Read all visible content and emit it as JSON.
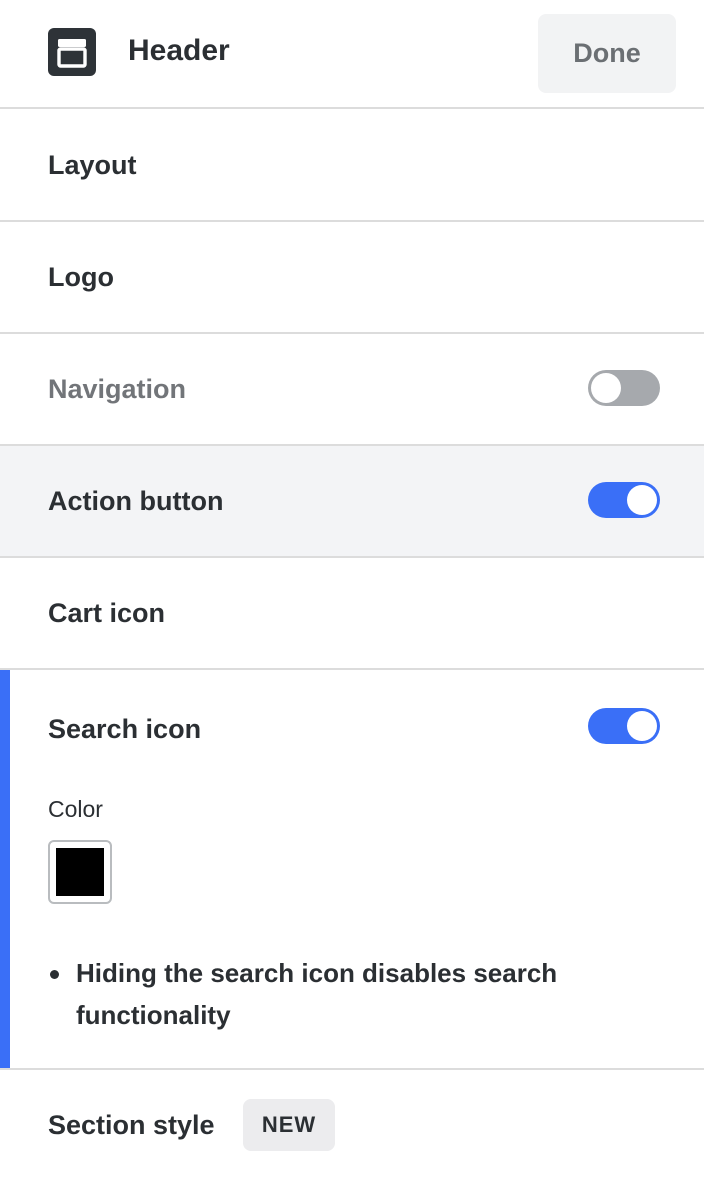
{
  "header": {
    "title": "Header",
    "icon": "header-layout-icon",
    "done_label": "Done"
  },
  "rows": {
    "layout": {
      "label": "Layout"
    },
    "logo": {
      "label": "Logo"
    },
    "navigation": {
      "label": "Navigation",
      "toggle": "off"
    },
    "action_button": {
      "label": "Action button",
      "toggle": "on"
    },
    "cart_icon": {
      "label": "Cart icon"
    },
    "search_icon": {
      "label": "Search icon",
      "toggle": "on",
      "color_label": "Color",
      "color_value": "#000000",
      "note": "Hiding the search icon disables search functionality"
    },
    "section_style": {
      "label": "Section style",
      "badge": "NEW"
    }
  },
  "colors": {
    "accent": "#3a6ff7",
    "toggle_off": "#a6a9ad",
    "highlight_bg": "#f3f4f6"
  }
}
